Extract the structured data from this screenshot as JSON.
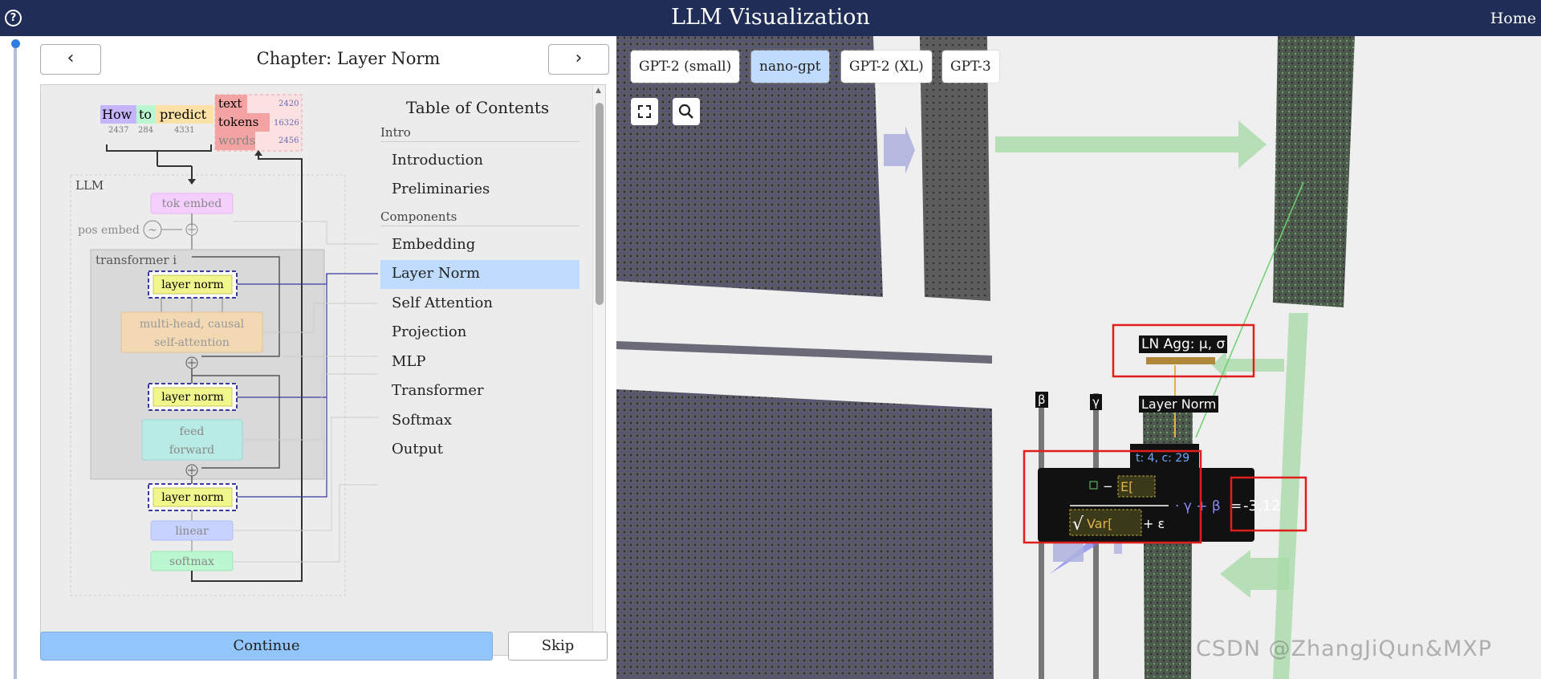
{
  "app": {
    "title": "LLM Visualization",
    "home": "Home",
    "help": "?"
  },
  "panel": {
    "chapter_title": "Chapter: Layer Norm",
    "prev_icon": "‹",
    "next_icon": "›",
    "continue_label": "Continue",
    "skip_label": "Skip"
  },
  "toc": {
    "title": "Table of Contents",
    "sections": [
      {
        "label": "Intro",
        "items": [
          "Introduction",
          "Preliminaries"
        ]
      },
      {
        "label": "Components",
        "items": [
          "Embedding",
          "Layer Norm",
          "Self Attention",
          "Projection",
          "MLP",
          "Transformer",
          "Softmax",
          "Output"
        ]
      }
    ],
    "active": "Layer Norm"
  },
  "diagram": {
    "tokens": [
      {
        "word": "How",
        "id": "2437",
        "color": "#c4b5fd"
      },
      {
        "word": "to",
        "id": "284",
        "color": "#bbf7d0"
      },
      {
        "word": "predict",
        "id": "4331",
        "color": "#fde2a7"
      }
    ],
    "stats": [
      {
        "label": "text",
        "value": "2420"
      },
      {
        "label": "tokens",
        "value": "16326"
      },
      {
        "label": "words",
        "value": "2456"
      }
    ],
    "llm_label": "LLM",
    "tok_embed": "tok embed",
    "pos_embed": "pos embed",
    "transformer": "transformer i",
    "layer_norm": "layer norm",
    "attention_1": "multi-head, causal",
    "attention_2": "self-attention",
    "ff_1": "feed",
    "ff_2": "forward",
    "linear": "linear",
    "softmax": "softmax"
  },
  "viewport": {
    "models": [
      "GPT-2 (small)",
      "nano-gpt",
      "GPT-2 (XL)",
      "GPT-3"
    ],
    "active_model": "nano-gpt",
    "ln_agg_label": "LN Agg: μ, σ",
    "layer_norm_label": "Layer Norm",
    "beta": "β",
    "gamma": "γ",
    "formula_coord": "t: 4, c: 29",
    "formula_mean": "E[",
    "formula_var": "Var[",
    "formula_eps": "+ ε",
    "formula_gamma": "· γ + β",
    "formula_eq": "=",
    "result": "-3.12",
    "watermark": "CSDN @ZhangJiQun&MXP"
  }
}
